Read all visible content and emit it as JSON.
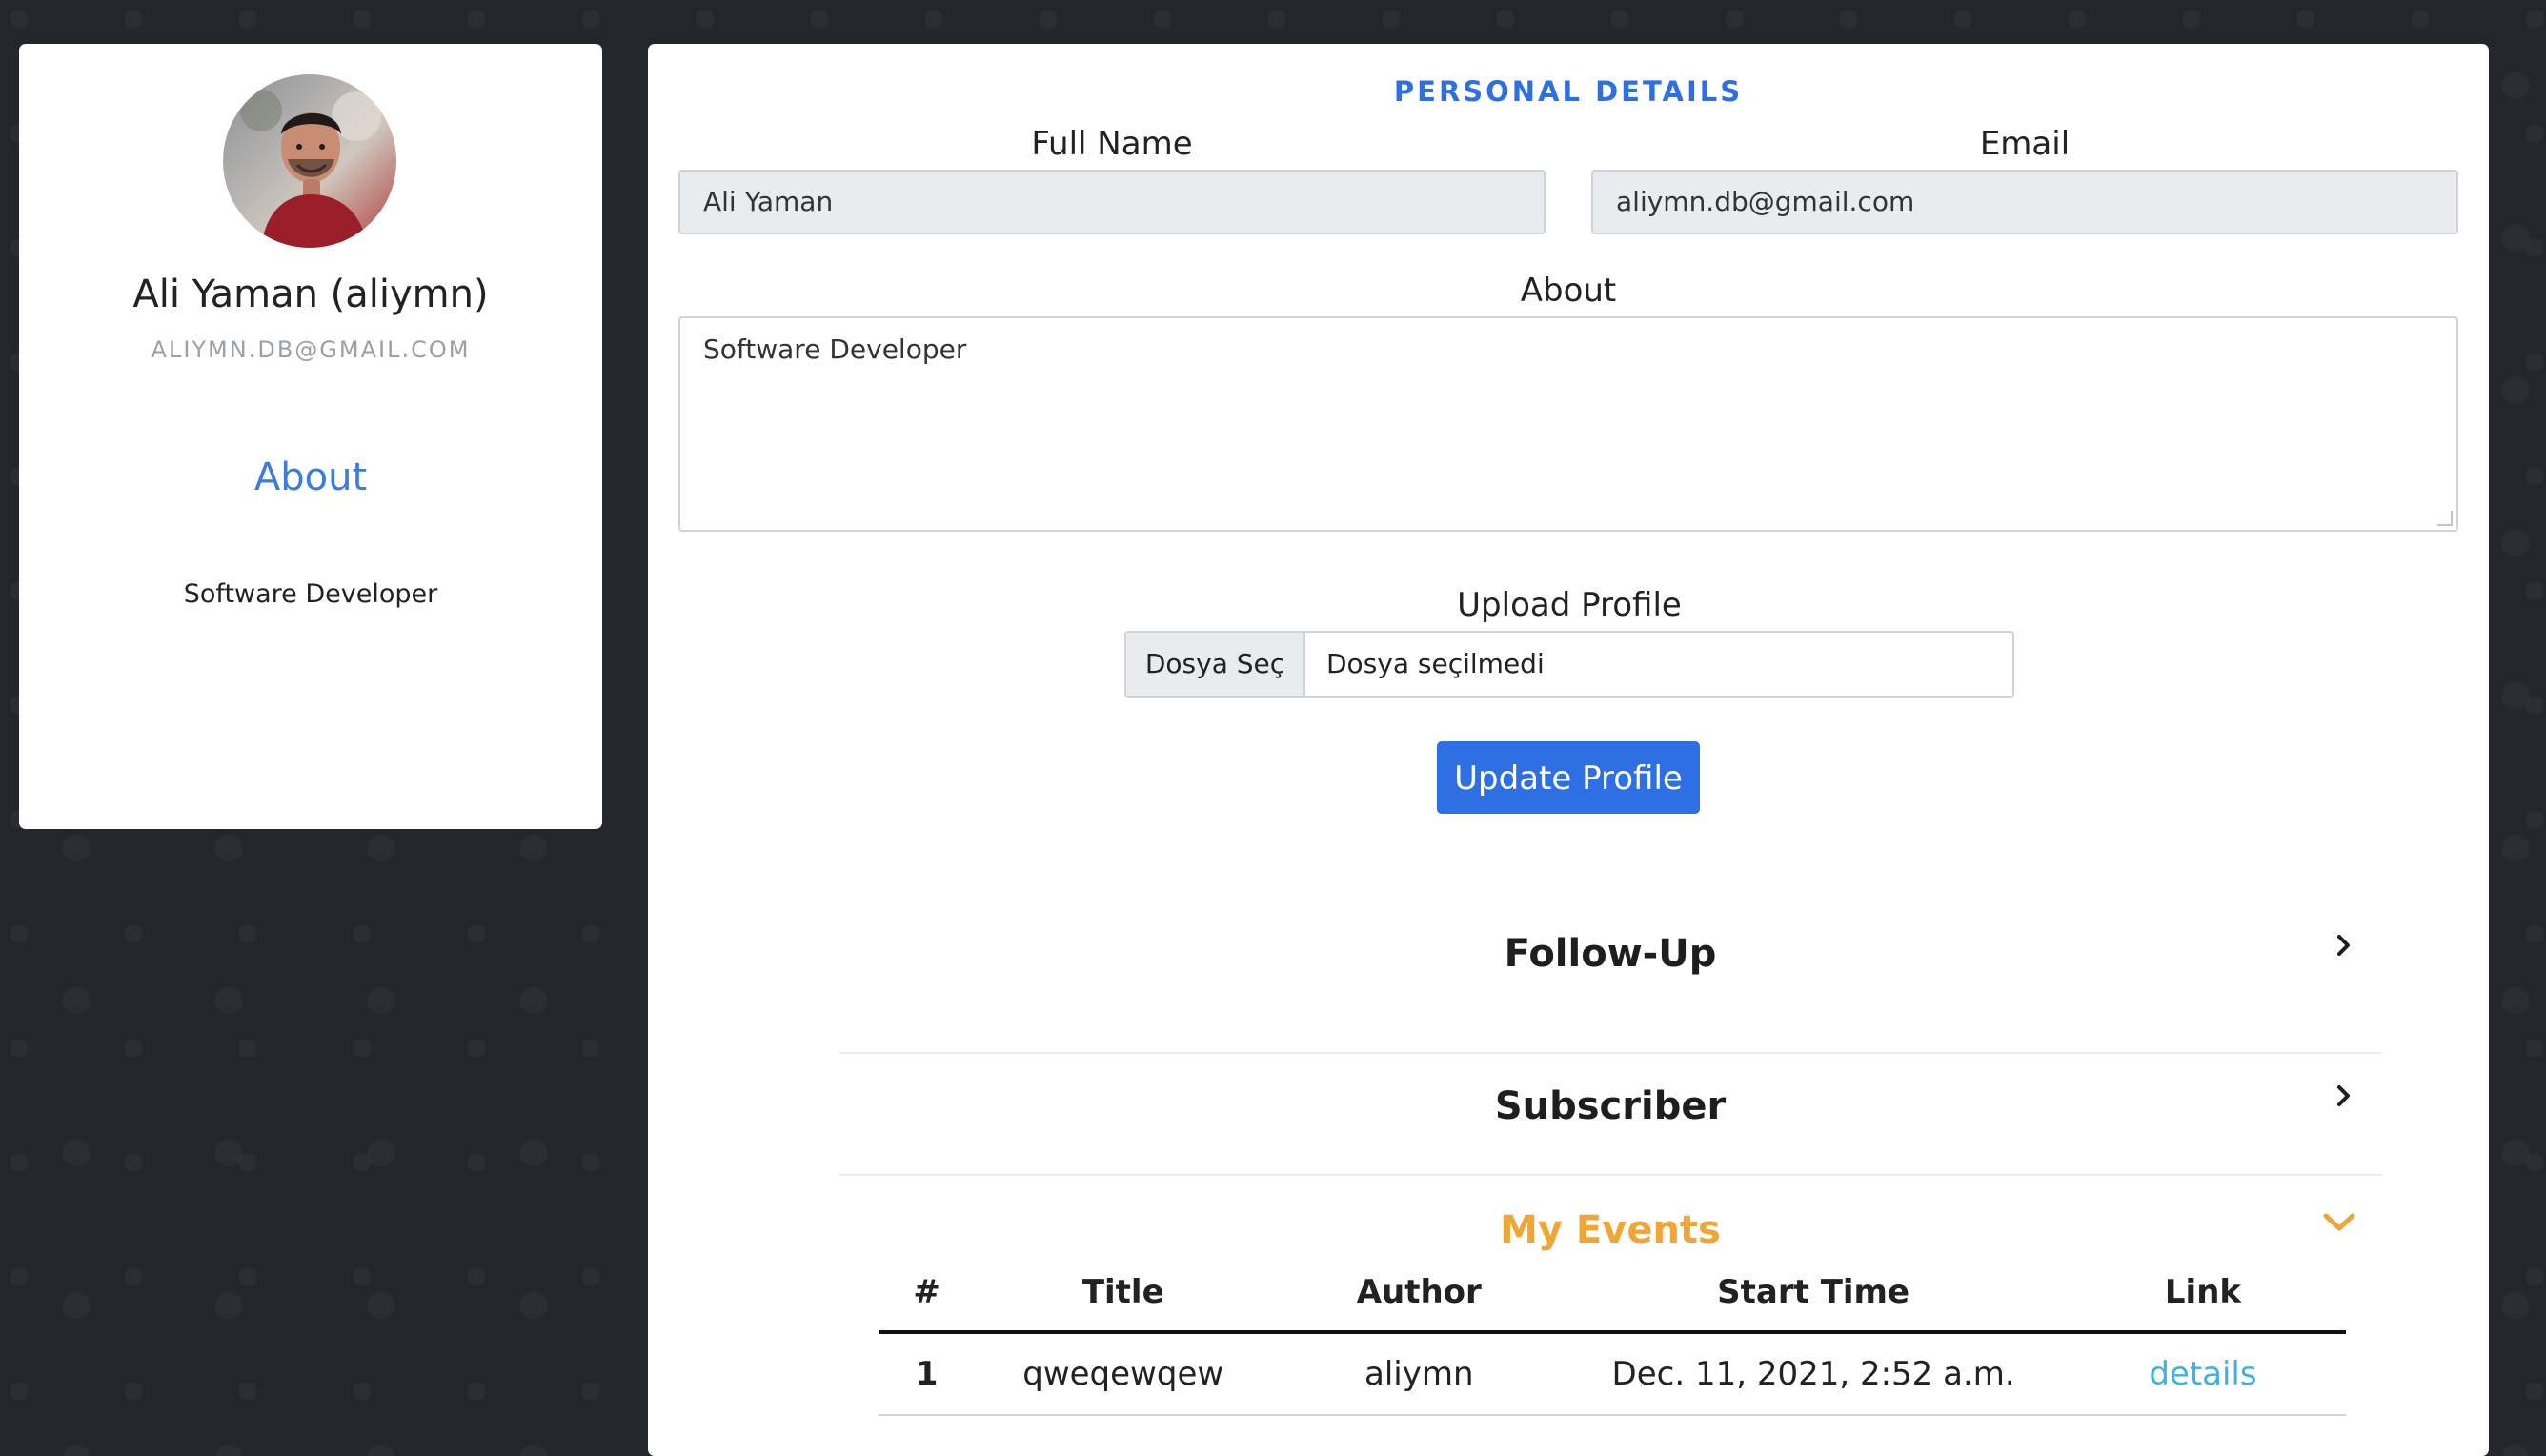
{
  "colors": {
    "accent": "#2f6fe4",
    "about_heading": "#3b7ddd",
    "active_section": "#f0a637",
    "link": "#3fb0e8"
  },
  "profile": {
    "name": "Ali Yaman (aliymn)",
    "email": "ALIYMN.DB@GMAIL.COM",
    "about_heading": "About",
    "about_text": "Software Developer"
  },
  "personal_details": {
    "title": "PERSONAL DETAILS",
    "full_name_label": "Full Name",
    "full_name_value": "Ali Yaman",
    "email_label": "Email",
    "email_value": "aliymn.db@gmail.com",
    "about_label": "About",
    "about_value": "Software Developer",
    "upload_label": "Upload Profile",
    "file_button": "Dosya Seç",
    "file_status": "Dosya seçilmedi",
    "update_button": "Update Profile"
  },
  "sections": [
    {
      "title": "Follow-Up",
      "icon": "chevron-right-icon"
    },
    {
      "title": "Subscriber",
      "icon": "chevron-right-icon"
    },
    {
      "title": "My Events",
      "icon": "chevron-down-icon"
    }
  ],
  "events_table": {
    "columns": [
      "#",
      "Title",
      "Author",
      "Start Time",
      "Link"
    ],
    "rows": [
      [
        "1",
        "qweqewqew",
        "aliymn",
        "Dec. 11, 2021, 2:52 a.m.",
        "details"
      ]
    ]
  }
}
